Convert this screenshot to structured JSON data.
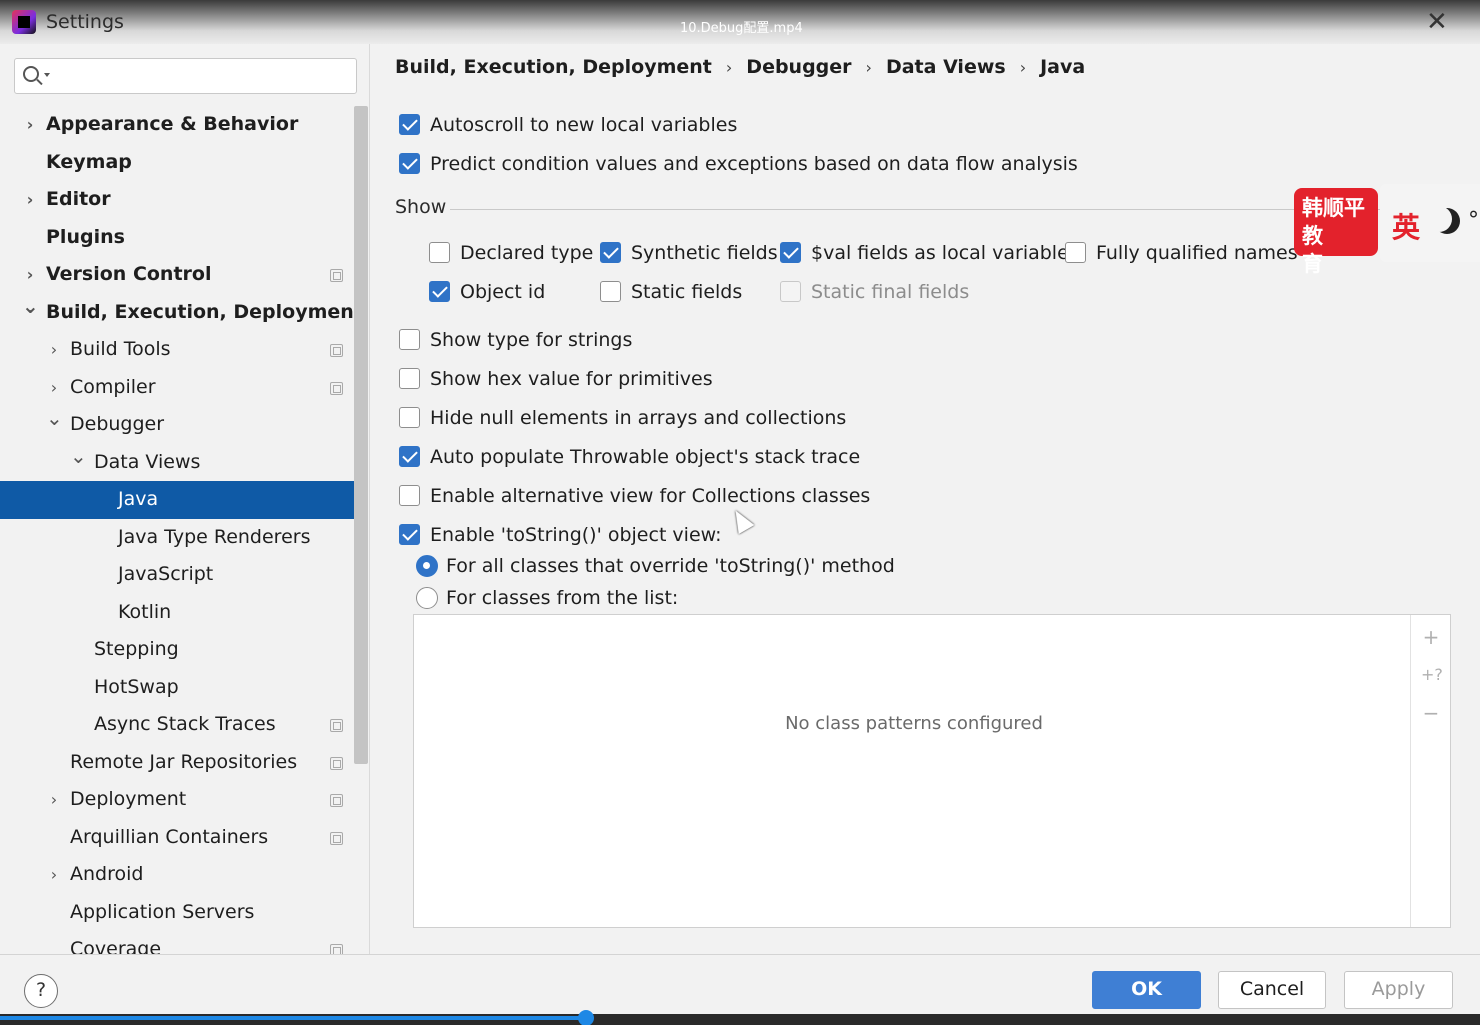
{
  "window": {
    "title": "Settings",
    "video_title": "10.Debug配置.mp4"
  },
  "search": {
    "placeholder": "",
    "value": ""
  },
  "sidebar": {
    "items": [
      {
        "label": "Appearance & Behavior",
        "level": 0,
        "expander": "collapsed",
        "bold": true,
        "project_icon": false
      },
      {
        "label": "Keymap",
        "level": 0,
        "expander": "none",
        "bold": true,
        "project_icon": false
      },
      {
        "label": "Editor",
        "level": 0,
        "expander": "collapsed",
        "bold": true,
        "project_icon": false
      },
      {
        "label": "Plugins",
        "level": 0,
        "expander": "none",
        "bold": true,
        "project_icon": false
      },
      {
        "label": "Version Control",
        "level": 0,
        "expander": "collapsed",
        "bold": true,
        "project_icon": true
      },
      {
        "label": "Build, Execution, Deployment",
        "level": 0,
        "expander": "expanded",
        "bold": true,
        "project_icon": false
      },
      {
        "label": "Build Tools",
        "level": 1,
        "expander": "collapsed",
        "bold": false,
        "project_icon": true
      },
      {
        "label": "Compiler",
        "level": 1,
        "expander": "collapsed",
        "bold": false,
        "project_icon": true
      },
      {
        "label": "Debugger",
        "level": 1,
        "expander": "expanded",
        "bold": false,
        "project_icon": false
      },
      {
        "label": "Data Views",
        "level": 2,
        "expander": "expanded",
        "bold": false,
        "project_icon": false
      },
      {
        "label": "Java",
        "level": 3,
        "expander": "none",
        "bold": false,
        "project_icon": false,
        "selected": true
      },
      {
        "label": "Java Type Renderers",
        "level": 3,
        "expander": "none",
        "bold": false,
        "project_icon": false
      },
      {
        "label": "JavaScript",
        "level": 3,
        "expander": "none",
        "bold": false,
        "project_icon": false
      },
      {
        "label": "Kotlin",
        "level": 3,
        "expander": "none",
        "bold": false,
        "project_icon": false
      },
      {
        "label": "Stepping",
        "level": 2,
        "expander": "none",
        "bold": false,
        "project_icon": false
      },
      {
        "label": "HotSwap",
        "level": 2,
        "expander": "none",
        "bold": false,
        "project_icon": false
      },
      {
        "label": "Async Stack Traces",
        "level": 2,
        "expander": "none",
        "bold": false,
        "project_icon": true
      },
      {
        "label": "Remote Jar Repositories",
        "level": 1,
        "expander": "none",
        "bold": false,
        "project_icon": true
      },
      {
        "label": "Deployment",
        "level": 1,
        "expander": "collapsed",
        "bold": false,
        "project_icon": true
      },
      {
        "label": "Arquillian Containers",
        "level": 1,
        "expander": "none",
        "bold": false,
        "project_icon": true
      },
      {
        "label": "Android",
        "level": 1,
        "expander": "collapsed",
        "bold": false,
        "project_icon": false
      },
      {
        "label": "Application Servers",
        "level": 1,
        "expander": "none",
        "bold": false,
        "project_icon": false
      },
      {
        "label": "Coverage",
        "level": 1,
        "expander": "none",
        "bold": false,
        "project_icon": true
      }
    ]
  },
  "breadcrumb": {
    "items": [
      "Build, Execution, Deployment",
      "Debugger",
      "Data Views",
      "Java"
    ],
    "separator": "›"
  },
  "options": {
    "autoscroll": {
      "label": "Autoscroll to new local variables",
      "checked": true
    },
    "predict": {
      "label": "Predict condition values and exceptions based on data flow analysis",
      "checked": true
    }
  },
  "show": {
    "label": "Show",
    "declared_type": {
      "label": "Declared type",
      "checked": false
    },
    "synthetic_fields": {
      "label": "Synthetic fields",
      "checked": true
    },
    "val_fields": {
      "label": "$val fields as local variables",
      "checked": true
    },
    "fully_qualified": {
      "label": "Fully qualified names",
      "checked": false
    },
    "object_id": {
      "label": "Object id",
      "checked": true
    },
    "static_fields": {
      "label": "Static fields",
      "checked": false
    },
    "static_final_fields": {
      "label": "Static final fields",
      "checked": false,
      "disabled": true
    }
  },
  "more_options": {
    "type_strings": {
      "label": "Show type for strings",
      "checked": false
    },
    "hex_primitives": {
      "label": "Show hex value for primitives",
      "checked": false
    },
    "hide_null": {
      "label": "Hide null elements in arrays and collections",
      "checked": false
    },
    "auto_populate": {
      "label": "Auto populate Throwable object's stack trace",
      "checked": true
    },
    "alt_view": {
      "label": "Enable alternative view for Collections classes",
      "checked": false
    },
    "tostring": {
      "label": "Enable 'toString()' object view:",
      "checked": true
    }
  },
  "tostring_mode": {
    "all_classes": {
      "label": "For all classes that override 'toString()' method",
      "selected": true
    },
    "from_list": {
      "label": "For classes from the list:",
      "selected": false
    }
  },
  "pattern_list": {
    "empty_text": "No class patterns configured",
    "toolbar": [
      "+",
      "+?",
      "−"
    ]
  },
  "watermark": {
    "line1": "韩顺平",
    "line2": "教育",
    "ime_char": "英"
  },
  "buttons": {
    "help": "?",
    "ok": "OK",
    "cancel": "Cancel",
    "apply": "Apply"
  },
  "video_progress": 0.396,
  "colors": {
    "selection": "#0f5aa6",
    "checkbox_checked": "#2f73c7",
    "primary_button": "#3f7fd4",
    "watermark_red": "#e3222c"
  }
}
